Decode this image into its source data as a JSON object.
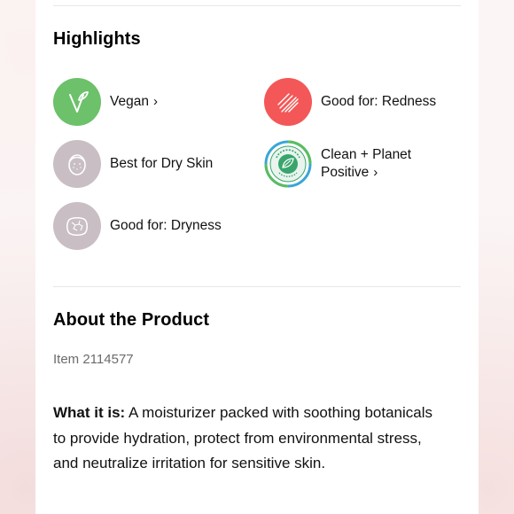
{
  "highlights": {
    "title": "Highlights",
    "items": [
      {
        "label": "Vegan",
        "chevron": "›",
        "icon": "leaf-icon",
        "color": "#6cc16a"
      },
      {
        "label": "Good for: Redness",
        "chevron": "",
        "icon": "redness-icon",
        "color": "#f35757"
      },
      {
        "label": "Best for Dry Skin",
        "chevron": "",
        "icon": "face-icon",
        "color": "#c8bec3"
      },
      {
        "label_line1": "Clean + Planet",
        "label_line2": "Positive",
        "chevron": "›",
        "icon": "clean-planet-positive-badge-icon",
        "color": "#39a56d"
      },
      {
        "label": "Good for: Dryness",
        "chevron": "",
        "icon": "dryness-icon",
        "color": "#c8bec3"
      }
    ]
  },
  "about": {
    "title": "About the Product",
    "item_number": "Item 2114577",
    "what_it_is_label": "What it is:",
    "what_it_is_text": " A moisturizer packed with soothing botanicals to provide hydration, protect from environmental stress, and neutralize irritation for sensitive skin."
  }
}
